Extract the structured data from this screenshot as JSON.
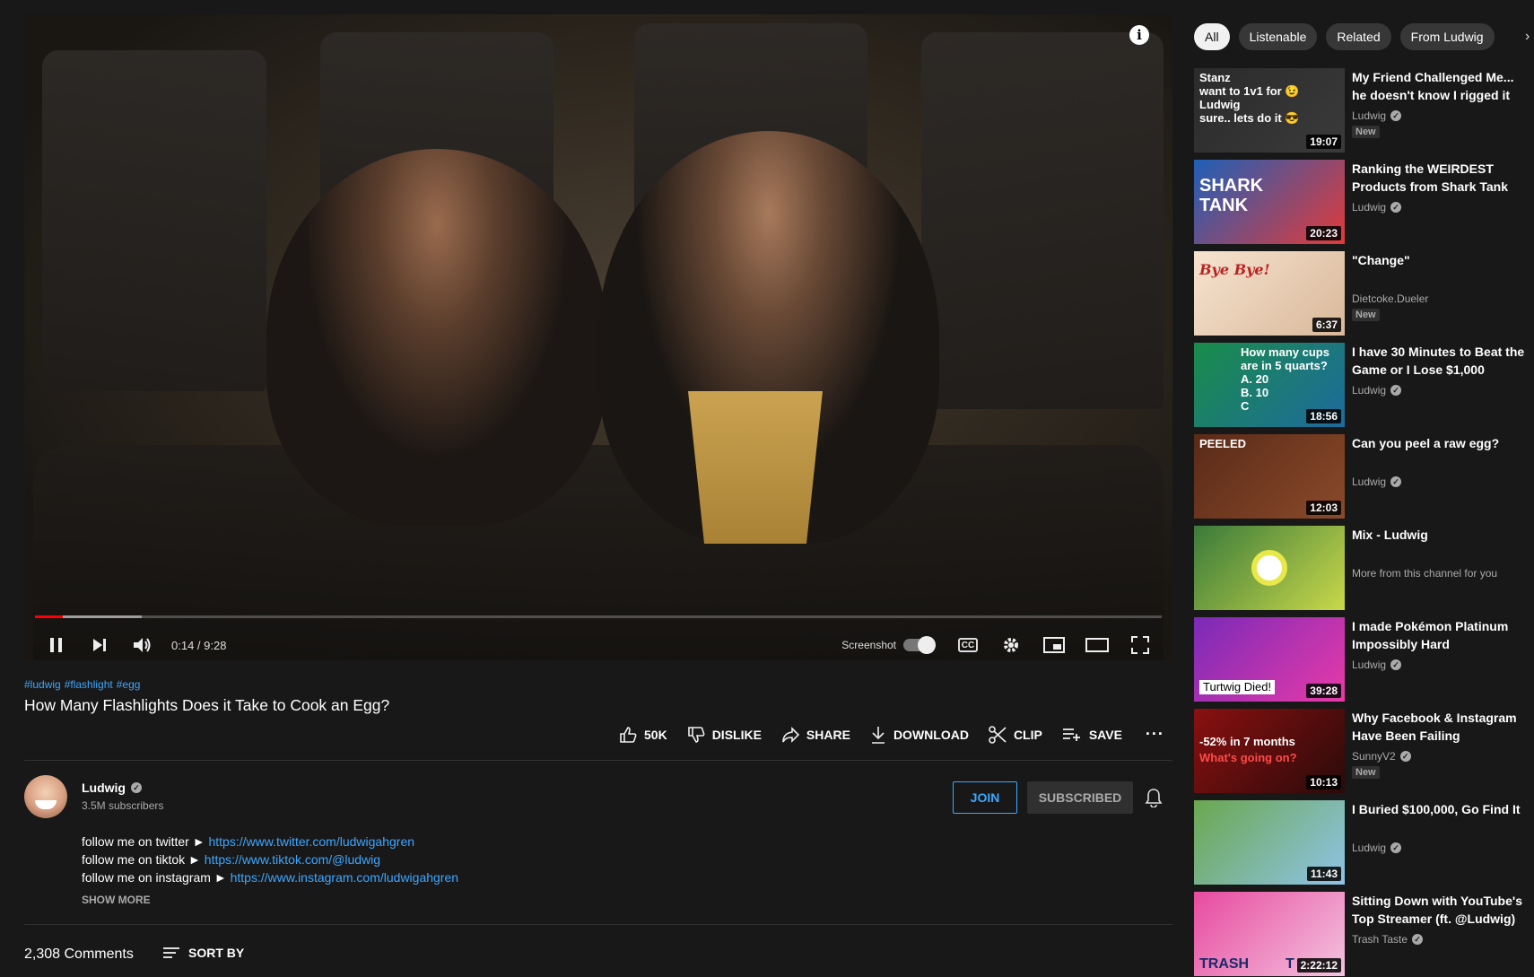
{
  "player": {
    "time": "0:14 / 9:28",
    "screenshot_label": "Screenshot",
    "progress_played": 0.025,
    "progress_loaded": 0.095
  },
  "video": {
    "hashtags": [
      "#ludwig",
      "#flashlight",
      "#egg"
    ],
    "title": "How Many Flashlights Does it Take to Cook an Egg?",
    "actions": {
      "like": "50K",
      "dislike": "DISLIKE",
      "share": "SHARE",
      "download": "DOWNLOAD",
      "clip": "CLIP",
      "save": "SAVE"
    }
  },
  "channel": {
    "name": "Ludwig",
    "subscribers": "3.5M subscribers",
    "join": "JOIN",
    "subscribed": "SUBSCRIBED"
  },
  "description": {
    "lines": [
      {
        "prefix": "follow me on twitter ► ",
        "link": "https://www.twitter.com/ludwigahgren"
      },
      {
        "prefix": "follow me on tiktok ► ",
        "link": "https://www.tiktok.com/@ludwig"
      },
      {
        "prefix": "follow me on instagram ► ",
        "link": "https://www.instagram.com/ludwigahgren"
      }
    ],
    "show_more": "SHOW MORE"
  },
  "comments": {
    "count": "2,308 Comments",
    "sort_by": "SORT BY"
  },
  "sidebar": {
    "chips": [
      "All",
      "Listenable",
      "Related",
      "From Ludwig"
    ],
    "recommendations": [
      {
        "title": "My Friend Challenged Me... he doesn't know I rigged it",
        "channel": "Ludwig",
        "verified": true,
        "duration": "19:07",
        "badge": "New",
        "thumb_colors": [
          "#2b2b2b",
          "#3a3a3a"
        ],
        "thumb_text": [
          "Stanz",
          "want to 1v1 for 😉",
          "Ludwig",
          "sure.. lets do it 😎"
        ]
      },
      {
        "title": "Ranking the WEIRDEST Products from Shark Tank",
        "channel": "Ludwig",
        "verified": true,
        "duration": "20:23",
        "badge": "",
        "thumb_colors": [
          "#1e5fb8",
          "#e23a3a"
        ],
        "thumb_text": [
          "SHARK",
          "TANK"
        ]
      },
      {
        "title": "\"Change\"",
        "channel": "Dietcoke.Dueler",
        "verified": false,
        "duration": "6:37",
        "badge": "New",
        "thumb_colors": [
          "#f6e3cf",
          "#d9b89a"
        ],
        "thumb_text": [
          "Bye Bye!"
        ]
      },
      {
        "title": "I have 30 Minutes to Beat the Game or I Lose $1,000",
        "channel": "Ludwig",
        "verified": true,
        "duration": "18:56",
        "badge": "",
        "thumb_colors": [
          "#1a8c4a",
          "#1d6a9e"
        ],
        "thumb_text": [
          "How many cups",
          "are in 5 quarts?",
          "A. 20",
          "B. 10",
          "C"
        ]
      },
      {
        "title": "Can you peel a raw egg?",
        "channel": "Ludwig",
        "verified": true,
        "duration": "12:03",
        "badge": "",
        "thumb_colors": [
          "#5a2a18",
          "#8a4a2a"
        ],
        "thumb_text": [
          "PEELED"
        ]
      },
      {
        "title": "Mix - Ludwig",
        "channel": "More from this channel for you",
        "verified": false,
        "duration": "",
        "badge": "",
        "thumb_colors": [
          "#3a7a3a",
          "#c9d84a"
        ],
        "thumb_text": []
      },
      {
        "title": "I made Pokémon Platinum Impossibly Hard",
        "channel": "Ludwig",
        "verified": true,
        "duration": "39:28",
        "badge": "",
        "thumb_colors": [
          "#7a2ab8",
          "#e83aa8"
        ],
        "thumb_text": [
          "Turtwig Died!"
        ]
      },
      {
        "title": "Why Facebook & Instagram Have Been Failing",
        "channel": "SunnyV2",
        "verified": true,
        "duration": "10:13",
        "badge": "New",
        "thumb_colors": [
          "#8a1010",
          "#2a0a0a"
        ],
        "thumb_text": [
          "-52% in 7 months",
          "What's going on?"
        ]
      },
      {
        "title": "I Buried $100,000, Go Find It",
        "channel": "Ludwig",
        "verified": true,
        "duration": "11:43",
        "badge": "",
        "thumb_colors": [
          "#6aa84f",
          "#8fc3e8"
        ],
        "thumb_text": []
      },
      {
        "title": "Sitting Down with YouTube's Top Streamer (ft. @Ludwig) |...",
        "channel": "Trash Taste",
        "verified": true,
        "duration": "2:22:12",
        "badge": "",
        "thumb_colors": [
          "#e84aa0",
          "#f3c3de"
        ],
        "thumb_text": [
          "TRASH",
          "T"
        ]
      }
    ]
  }
}
